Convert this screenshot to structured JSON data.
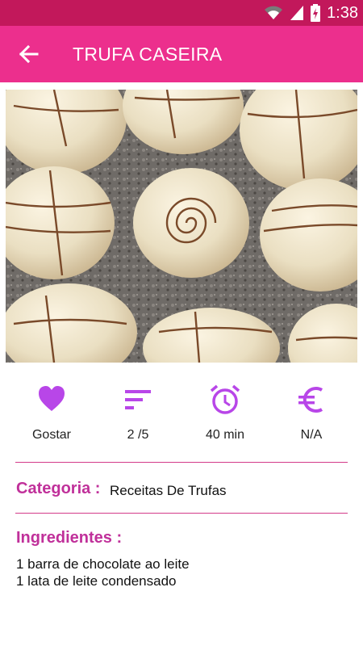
{
  "status_bar": {
    "time": "1:38",
    "icons": [
      "wifi-icon",
      "signal-icon",
      "battery-charging-icon"
    ]
  },
  "app_bar": {
    "title": "TRUFA CASEIRA",
    "back_icon": "arrow-back-icon"
  },
  "photo": {
    "description_icon": "recipe-photo"
  },
  "stats": [
    {
      "icon": "heart-icon",
      "label": "Gostar"
    },
    {
      "icon": "difficulty-bars-icon",
      "label": "2 /5"
    },
    {
      "icon": "alarm-clock-icon",
      "label": "40 min"
    },
    {
      "icon": "euro-icon",
      "label": "N/A"
    }
  ],
  "category": {
    "title": "Categoria :",
    "value": "Receitas De Trufas"
  },
  "ingredients": {
    "title": "Ingredientes :",
    "items": [
      "1 barra de chocolate ao leite",
      "1 lata de leite condensado"
    ]
  },
  "colors": {
    "status_bar": "#c2185b",
    "app_bar": "#ec2f8d",
    "accent": "#c040e0",
    "section_title": "#c0309a",
    "divider": "#d43b8a"
  }
}
